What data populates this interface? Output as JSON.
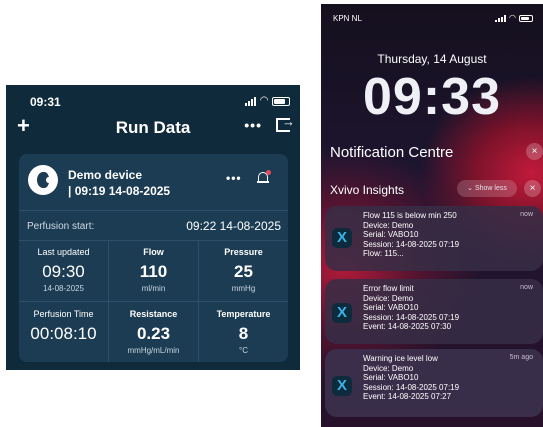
{
  "left": {
    "status": {
      "time": "09:31"
    },
    "header": {
      "title": "Run Data",
      "add_icon": "+",
      "more_icon": "•••"
    },
    "device": {
      "name": "Demo device",
      "started": "| 09:19 14-08-2025",
      "more_icon": "•••"
    },
    "perfusion_start": {
      "label": "Perfusion start:",
      "value": "09:22 14-08-2025"
    },
    "metrics": [
      {
        "label": "Last updated",
        "value": "09:30",
        "unit": "14-08-2025"
      },
      {
        "label": "Flow",
        "value": "110",
        "unit": "ml/min"
      },
      {
        "label": "Pressure",
        "value": "25",
        "unit": "mmHg"
      },
      {
        "label": "Perfusion Time",
        "value": "00:08:10",
        "unit": ""
      },
      {
        "label": "Resistance",
        "value": "0.23",
        "unit": "mmHg/mL/min"
      },
      {
        "label": "Temperature",
        "value": "8",
        "unit": "°C"
      }
    ]
  },
  "right": {
    "status": {
      "carrier": "KPN NL"
    },
    "date": "Thursday, 14 August",
    "clock": "09:33",
    "notification_centre": "Notification Centre",
    "app_name": "Xvivo Insights",
    "show_less": "Show less",
    "close_icon": "×",
    "app_icon": "X",
    "notifications": [
      {
        "title": "Flow 115 is below min 250",
        "when": "now",
        "lines": [
          "Device: Demo",
          "Serial: VABO10",
          "Session: 14-08-2025 07:19",
          "Flow: 115..."
        ]
      },
      {
        "title": "Error flow limit",
        "when": "now",
        "lines": [
          "Device: Demo",
          "Serial: VABO10",
          "Session: 14-08-2025 07:19",
          "Event: 14-08-2025 07:30"
        ]
      },
      {
        "title": "Warning ice level low",
        "when": "5m ago",
        "lines": [
          "Device: Demo",
          "Serial: VABO10",
          "Session: 14-08-2025 07:19",
          "Event: 14-08-2025 07:27"
        ]
      }
    ]
  },
  "colors": {
    "app_background": "#0f2a3b",
    "card_background": "#1b3c52",
    "alert_dot": "#e74b5a",
    "app_icon_accent": "#3bb3e6"
  },
  "icons": [
    "plus-icon",
    "more-icon",
    "exit-icon",
    "kidney-icon",
    "bell-icon",
    "signal-icon",
    "wifi-icon",
    "battery-icon",
    "close-icon",
    "chevron-down-icon",
    "xvivo-app-icon"
  ]
}
